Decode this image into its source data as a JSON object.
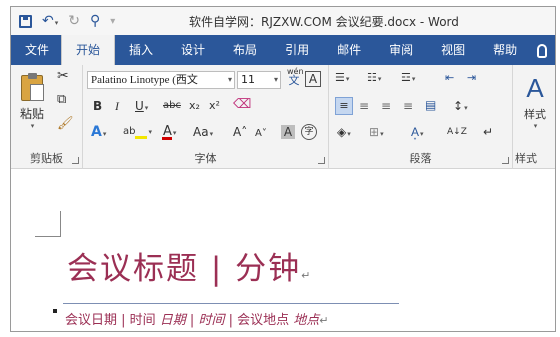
{
  "title": "软件自学网：RJZXW.COM    会议纪要.docx  -  Word",
  "tabs": [
    "文件",
    "开始",
    "插入",
    "设计",
    "布局",
    "引用",
    "邮件",
    "审阅",
    "视图",
    "帮助"
  ],
  "ribbon": {
    "paste_label": "粘贴",
    "font_name": "Palatino Linotype (西文",
    "font_size": "11",
    "wen_label": "wén",
    "wen_char": "文",
    "a_boxed": "A",
    "bold": "B",
    "italic": "I",
    "underline": "U",
    "strike": "abc",
    "subscript": "x₂",
    "superscript": "x²",
    "aa_label": "Aa",
    "grow_font": "A˄",
    "shrink_font": "A˅",
    "char_shade": "A",
    "enclose_char": "字",
    "sort": "A↓Z",
    "styles_label": "样式",
    "group_clipboard": "剪贴板",
    "group_font": "字体",
    "group_paragraph": "段落",
    "group_styles": "样式"
  },
  "document": {
    "title": "会议标题 | 分钟",
    "subline_parts": [
      "会议日期 | 时间 ",
      "日期",
      " | ",
      "时间",
      " | 会议地点 ",
      "地点"
    ]
  },
  "colors": {
    "ribbon_blue": "#2b579a",
    "heading": "#9b2f54"
  }
}
